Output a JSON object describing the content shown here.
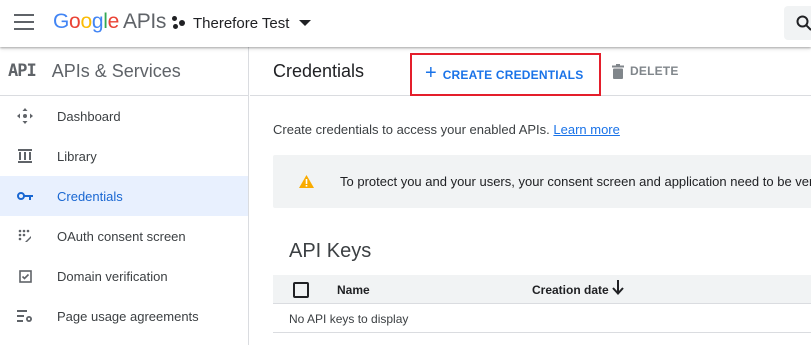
{
  "header": {
    "logo_letters": [
      "G",
      "o",
      "o",
      "g",
      "l",
      "e"
    ],
    "logo_suffix": "APIs",
    "project_name": "Therefore Test"
  },
  "sidebar": {
    "badge": "API",
    "title": "APIs & Services",
    "items": [
      {
        "label": "Dashboard",
        "icon": "dashboard-icon",
        "active": false
      },
      {
        "label": "Library",
        "icon": "library-icon",
        "active": false
      },
      {
        "label": "Credentials",
        "icon": "key-icon",
        "active": true
      },
      {
        "label": "OAuth consent screen",
        "icon": "oauth-consent-icon",
        "active": false
      },
      {
        "label": "Domain verification",
        "icon": "checkbox-icon",
        "active": false
      },
      {
        "label": "Page usage agreements",
        "icon": "settings-list-icon",
        "active": false
      }
    ]
  },
  "main": {
    "title": "Credentials",
    "create_label": "CREATE CREDENTIALS",
    "delete_label": "DELETE",
    "intro_text": "Create credentials to access your enabled APIs. ",
    "learn_more": "Learn more",
    "banner_text": "To protect you and your users, your consent screen and application need to be verified",
    "section_title": "API Keys",
    "table": {
      "columns": [
        "Name",
        "Creation date"
      ],
      "empty_text": "No API keys to display"
    }
  },
  "colors": {
    "accent": "#1a73e8",
    "highlight_box": "#e41e2b",
    "active_bg": "#e8f0fe",
    "warning": "#f9ab00"
  }
}
